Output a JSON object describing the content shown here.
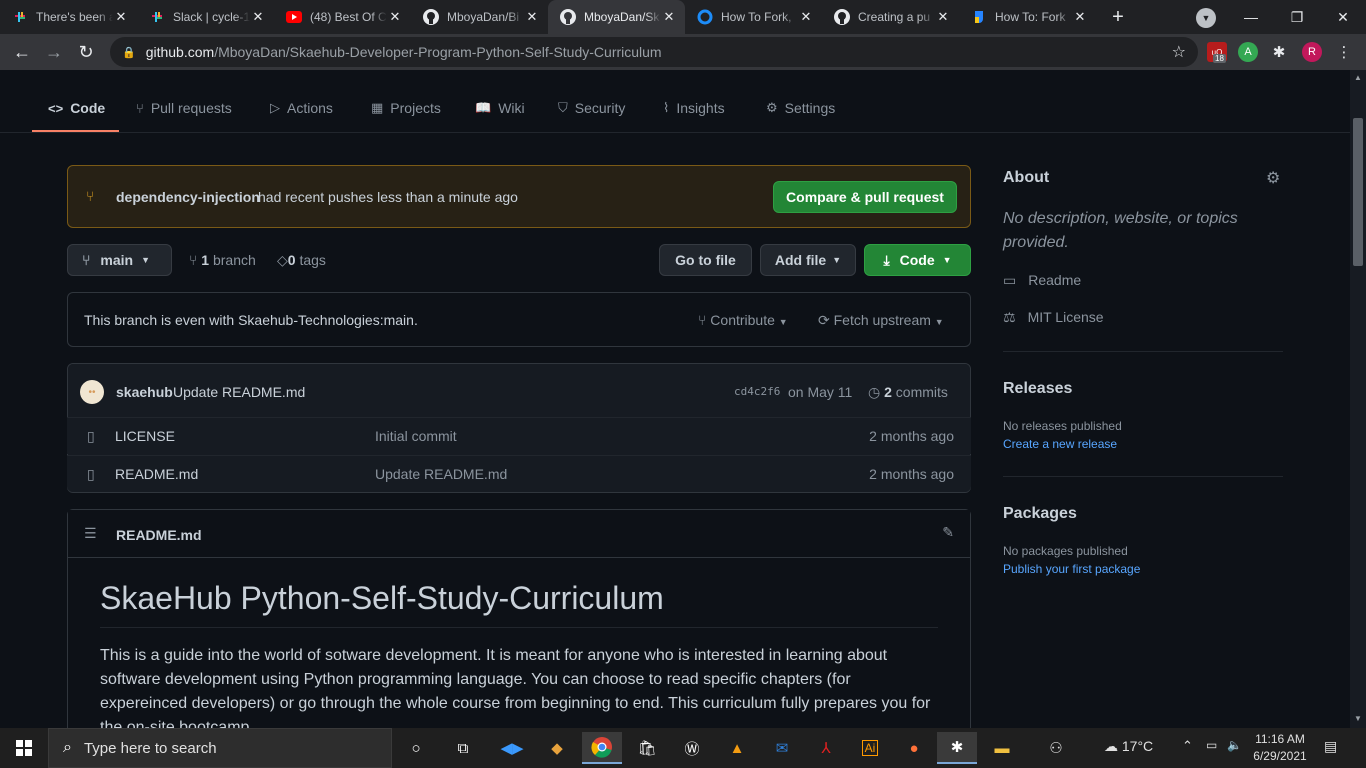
{
  "browser": {
    "tabs": [
      {
        "title": "There's been a",
        "icon": "slack-icon"
      },
      {
        "title": "Slack | cycle-1",
        "icon": "slack-icon"
      },
      {
        "title": "(48) Best Of C",
        "icon": "youtube-icon"
      },
      {
        "title": "MboyaDan/Bi",
        "icon": "github-icon"
      },
      {
        "title": "MboyaDan/Sk",
        "icon": "github-icon",
        "active": true
      },
      {
        "title": "How To Fork,",
        "icon": "link-icon"
      },
      {
        "title": "Creating a pu",
        "icon": "github-icon"
      },
      {
        "title": "How To: Fork",
        "icon": "jira-icon"
      }
    ],
    "url_host": "github.com",
    "url_path": "/MboyaDan/Skaehub-Developer-Program-Python-Self-Study-Curriculum",
    "ext_badge": "18",
    "ext_a": "A",
    "profile": "R"
  },
  "repo_nav": {
    "code": "Code",
    "pull_requests": "Pull requests",
    "actions": "Actions",
    "projects": "Projects",
    "wiki": "Wiki",
    "security": "Security",
    "insights": "Insights",
    "settings": "Settings"
  },
  "flash": {
    "branch": "dependency-injection",
    "text": "had recent pushes less than a minute ago",
    "button": "Compare & pull request"
  },
  "toolbar": {
    "branch": "main",
    "branch_count": "1",
    "branch_label": "branch",
    "tag_count": "0",
    "tag_label": "tags",
    "go_to_file": "Go to file",
    "add_file": "Add file",
    "code": "Code"
  },
  "sync": {
    "text": "This branch is even with Skaehub-Technologies:main.",
    "contribute": "Contribute",
    "fetch": "Fetch upstream"
  },
  "commit": {
    "author": "skaehub",
    "message": "Update README.md",
    "sha": "cd4c2f6",
    "date": "on May 11",
    "count": "2",
    "count_label": "commits"
  },
  "files": [
    {
      "name": "LICENSE",
      "message": "Initial commit",
      "age": "2 months ago"
    },
    {
      "name": "README.md",
      "message": "Update README.md",
      "age": "2 months ago"
    }
  ],
  "readme": {
    "filename": "README.md",
    "heading": "SkaeHub Python-Self-Study-Curriculum",
    "para1": "This is a guide into the world of sotware development. It is meant for anyone who is interested in learning about",
    "para2": "software development using Python programming language. You can choose to read specific chapters (for",
    "para3": "expereinced developers) or go through the whole course from beginning to end. This curriculum fully prepares you for",
    "para4": "the on-site bootcamp."
  },
  "sidebar": {
    "about": "About",
    "about_desc1": "No description, website, or topics",
    "about_desc2": "provided.",
    "readme": "Readme",
    "license": "MIT License",
    "releases": "Releases",
    "no_releases": "No releases published",
    "create_release": "Create a new release",
    "packages": "Packages",
    "no_packages": "No packages published",
    "publish_package": "Publish your first package"
  },
  "taskbar": {
    "search": "Type here to search",
    "weather": "17°C",
    "time": "11:16 AM",
    "date": "6/29/2021"
  },
  "colors": {
    "accent": "#f78166",
    "green": "#238636",
    "link": "#58a6ff"
  }
}
